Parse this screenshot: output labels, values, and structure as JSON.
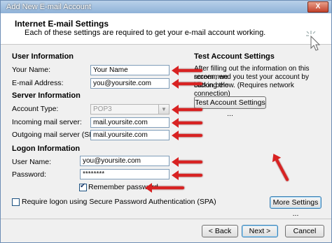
{
  "window": {
    "title": "Add New E-mail Account",
    "close_label": "X"
  },
  "header": {
    "title": "Internet E-mail Settings",
    "subtitle": "Each of these settings are required to get your e-mail account working."
  },
  "user_info": {
    "heading": "User Information",
    "name_label": "Your Name:",
    "name_value": "Your Name",
    "email_label": "E-mail Address:",
    "email_value": "you@yoursite.com"
  },
  "server_info": {
    "heading": "Server Information",
    "account_type_label": "Account Type:",
    "account_type_value": "POP3",
    "incoming_label": "Incoming mail server:",
    "incoming_value": "mail.yoursite.com",
    "outgoing_label": "Outgoing mail server (SMTP):",
    "outgoing_value": "mail.yoursite.com"
  },
  "logon_info": {
    "heading": "Logon Information",
    "username_label": "User Name:",
    "username_value": "you@yoursite.com",
    "password_label": "Password:",
    "password_value": "********",
    "remember_label": "Remember password",
    "remember_checked": true,
    "spa_label": "Require logon using Secure Password Authentication (SPA)",
    "spa_checked": false
  },
  "test_settings": {
    "heading": "Test Account Settings",
    "line1": "After filling out the information on this screen, we",
    "line2": "recommend you test your account by clicking the",
    "line3": "button below. (Requires network connection)",
    "button_label": "Test Account Settings ..."
  },
  "more_settings_label": "More Settings ...",
  "nav": {
    "back_label": "< Back",
    "next_label": "Next >",
    "cancel_label": "Cancel"
  },
  "colors": {
    "arrow": "#d82222",
    "accent": "#3c7fb1"
  }
}
